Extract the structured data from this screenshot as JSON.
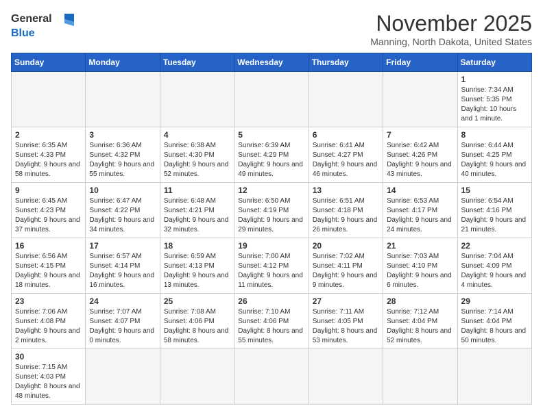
{
  "logo": {
    "line1": "General",
    "line2": "Blue"
  },
  "title": "November 2025",
  "subtitle": "Manning, North Dakota, United States",
  "days_header": [
    "Sunday",
    "Monday",
    "Tuesday",
    "Wednesday",
    "Thursday",
    "Friday",
    "Saturday"
  ],
  "weeks": [
    [
      {
        "day": "",
        "info": ""
      },
      {
        "day": "",
        "info": ""
      },
      {
        "day": "",
        "info": ""
      },
      {
        "day": "",
        "info": ""
      },
      {
        "day": "",
        "info": ""
      },
      {
        "day": "",
        "info": ""
      },
      {
        "day": "1",
        "info": "Sunrise: 7:34 AM\nSunset: 5:35 PM\nDaylight: 10 hours and 1 minute."
      }
    ],
    [
      {
        "day": "2",
        "info": "Sunrise: 6:35 AM\nSunset: 4:33 PM\nDaylight: 9 hours and 58 minutes."
      },
      {
        "day": "3",
        "info": "Sunrise: 6:36 AM\nSunset: 4:32 PM\nDaylight: 9 hours and 55 minutes."
      },
      {
        "day": "4",
        "info": "Sunrise: 6:38 AM\nSunset: 4:30 PM\nDaylight: 9 hours and 52 minutes."
      },
      {
        "day": "5",
        "info": "Sunrise: 6:39 AM\nSunset: 4:29 PM\nDaylight: 9 hours and 49 minutes."
      },
      {
        "day": "6",
        "info": "Sunrise: 6:41 AM\nSunset: 4:27 PM\nDaylight: 9 hours and 46 minutes."
      },
      {
        "day": "7",
        "info": "Sunrise: 6:42 AM\nSunset: 4:26 PM\nDaylight: 9 hours and 43 minutes."
      },
      {
        "day": "8",
        "info": "Sunrise: 6:44 AM\nSunset: 4:25 PM\nDaylight: 9 hours and 40 minutes."
      }
    ],
    [
      {
        "day": "9",
        "info": "Sunrise: 6:45 AM\nSunset: 4:23 PM\nDaylight: 9 hours and 37 minutes."
      },
      {
        "day": "10",
        "info": "Sunrise: 6:47 AM\nSunset: 4:22 PM\nDaylight: 9 hours and 34 minutes."
      },
      {
        "day": "11",
        "info": "Sunrise: 6:48 AM\nSunset: 4:21 PM\nDaylight: 9 hours and 32 minutes."
      },
      {
        "day": "12",
        "info": "Sunrise: 6:50 AM\nSunset: 4:19 PM\nDaylight: 9 hours and 29 minutes."
      },
      {
        "day": "13",
        "info": "Sunrise: 6:51 AM\nSunset: 4:18 PM\nDaylight: 9 hours and 26 minutes."
      },
      {
        "day": "14",
        "info": "Sunrise: 6:53 AM\nSunset: 4:17 PM\nDaylight: 9 hours and 24 minutes."
      },
      {
        "day": "15",
        "info": "Sunrise: 6:54 AM\nSunset: 4:16 PM\nDaylight: 9 hours and 21 minutes."
      }
    ],
    [
      {
        "day": "16",
        "info": "Sunrise: 6:56 AM\nSunset: 4:15 PM\nDaylight: 9 hours and 18 minutes."
      },
      {
        "day": "17",
        "info": "Sunrise: 6:57 AM\nSunset: 4:14 PM\nDaylight: 9 hours and 16 minutes."
      },
      {
        "day": "18",
        "info": "Sunrise: 6:59 AM\nSunset: 4:13 PM\nDaylight: 9 hours and 13 minutes."
      },
      {
        "day": "19",
        "info": "Sunrise: 7:00 AM\nSunset: 4:12 PM\nDaylight: 9 hours and 11 minutes."
      },
      {
        "day": "20",
        "info": "Sunrise: 7:02 AM\nSunset: 4:11 PM\nDaylight: 9 hours and 9 minutes."
      },
      {
        "day": "21",
        "info": "Sunrise: 7:03 AM\nSunset: 4:10 PM\nDaylight: 9 hours and 6 minutes."
      },
      {
        "day": "22",
        "info": "Sunrise: 7:04 AM\nSunset: 4:09 PM\nDaylight: 9 hours and 4 minutes."
      }
    ],
    [
      {
        "day": "23",
        "info": "Sunrise: 7:06 AM\nSunset: 4:08 PM\nDaylight: 9 hours and 2 minutes."
      },
      {
        "day": "24",
        "info": "Sunrise: 7:07 AM\nSunset: 4:07 PM\nDaylight: 9 hours and 0 minutes."
      },
      {
        "day": "25",
        "info": "Sunrise: 7:08 AM\nSunset: 4:06 PM\nDaylight: 8 hours and 58 minutes."
      },
      {
        "day": "26",
        "info": "Sunrise: 7:10 AM\nSunset: 4:06 PM\nDaylight: 8 hours and 55 minutes."
      },
      {
        "day": "27",
        "info": "Sunrise: 7:11 AM\nSunset: 4:05 PM\nDaylight: 8 hours and 53 minutes."
      },
      {
        "day": "28",
        "info": "Sunrise: 7:12 AM\nSunset: 4:04 PM\nDaylight: 8 hours and 52 minutes."
      },
      {
        "day": "29",
        "info": "Sunrise: 7:14 AM\nSunset: 4:04 PM\nDaylight: 8 hours and 50 minutes."
      }
    ],
    [
      {
        "day": "30",
        "info": "Sunrise: 7:15 AM\nSunset: 4:03 PM\nDaylight: 8 hours and 48 minutes."
      },
      {
        "day": "",
        "info": ""
      },
      {
        "day": "",
        "info": ""
      },
      {
        "day": "",
        "info": ""
      },
      {
        "day": "",
        "info": ""
      },
      {
        "day": "",
        "info": ""
      },
      {
        "day": "",
        "info": ""
      }
    ]
  ]
}
